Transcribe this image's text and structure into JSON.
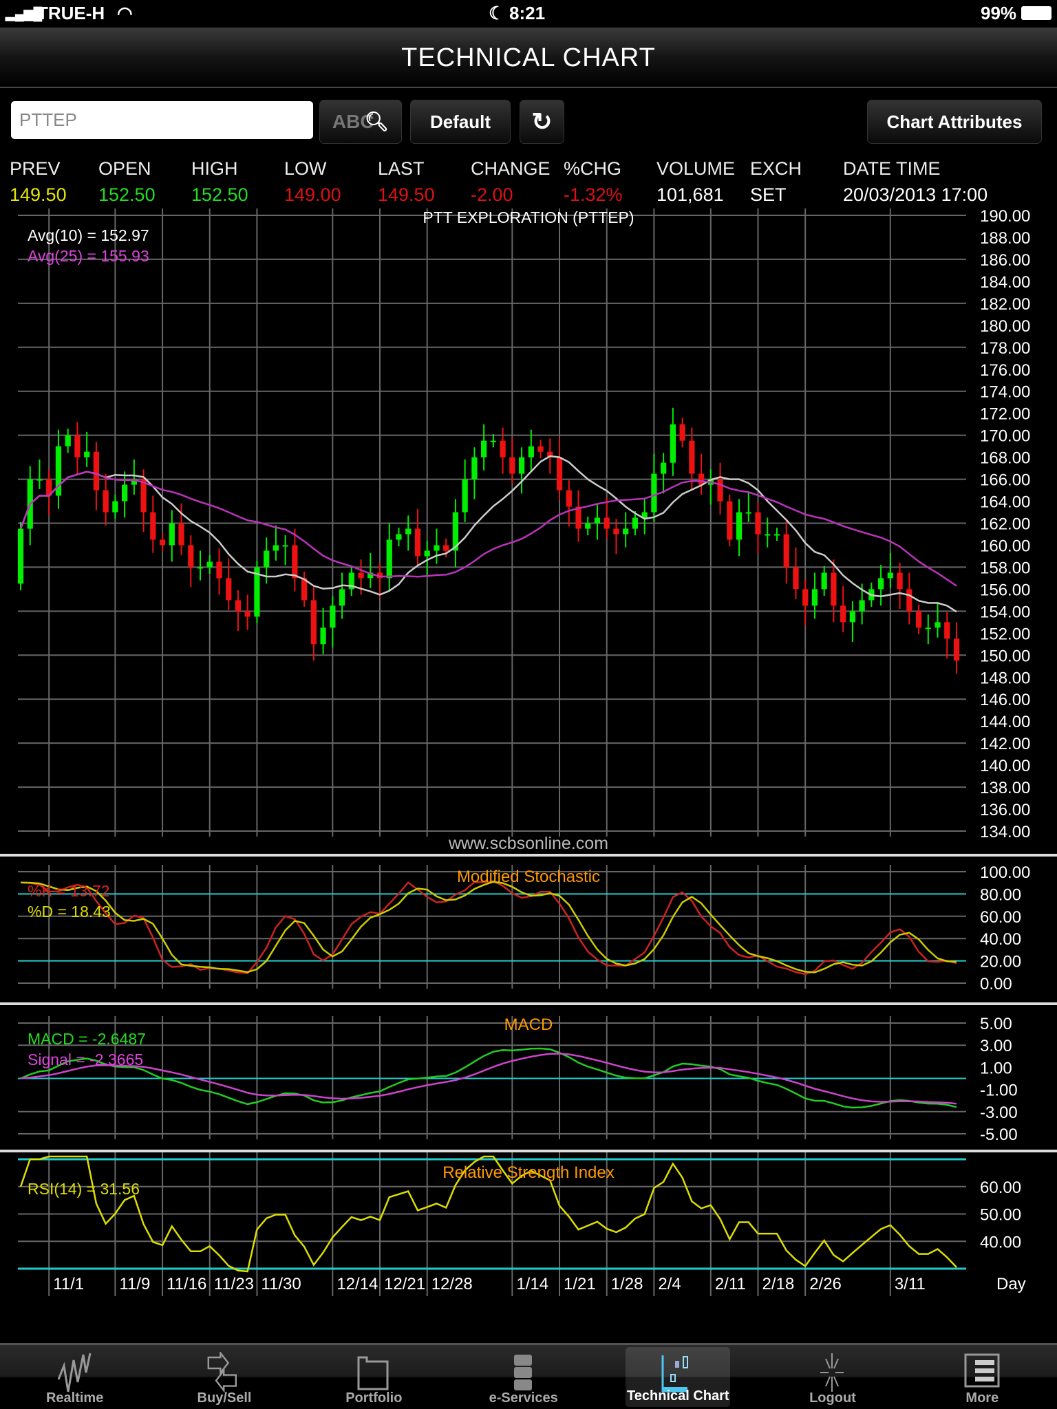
{
  "status": {
    "carrier": "TRUE-H",
    "time": "8:21",
    "battery": "99%"
  },
  "header": {
    "title": "TECHNICAL CHART"
  },
  "toolbar": {
    "symbol_value": "PTTEP",
    "abc_label": "ABC",
    "default_label": "Default",
    "chart_attributes_label": "Chart Attributes"
  },
  "quote": {
    "headers": [
      "PREV",
      "OPEN",
      "HIGH",
      "LOW",
      "LAST",
      "CHANGE",
      "%CHG",
      "VOLUME",
      "EXCH",
      "DATE TIME"
    ],
    "values": [
      "149.50",
      "152.50",
      "152.50",
      "149.00",
      "149.50",
      "-2.00",
      "-1.32%",
      "101,681",
      "SET",
      "20/03/2013 17:00"
    ],
    "colors": [
      "#e6e600",
      "#22dd22",
      "#22dd22",
      "#dd1111",
      "#dd1111",
      "#dd1111",
      "#dd1111",
      "#ffffff",
      "#ffffff",
      "#ffffff"
    ]
  },
  "chart_data": {
    "type": "candlestick",
    "title": "PTT EXPLORATION (PTTEP)",
    "watermark": "www.scbsonline.com",
    "xlabel": "Day",
    "x_labels": [
      {
        "label": "11/1",
        "index": 3
      },
      {
        "label": "11/9",
        "index": 10
      },
      {
        "label": "11/16",
        "index": 15
      },
      {
        "label": "11/23",
        "index": 20
      },
      {
        "label": "11/30",
        "index": 25
      },
      {
        "label": "12/14",
        "index": 33
      },
      {
        "label": "12/21",
        "index": 38
      },
      {
        "label": "12/28",
        "index": 43
      },
      {
        "label": "1/14",
        "index": 52
      },
      {
        "label": "1/21",
        "index": 57
      },
      {
        "label": "1/28",
        "index": 62
      },
      {
        "label": "2/4",
        "index": 67
      },
      {
        "label": "2/11",
        "index": 73
      },
      {
        "label": "2/18",
        "index": 78
      },
      {
        "label": "2/26",
        "index": 83
      },
      {
        "label": "3/11",
        "index": 92
      }
    ],
    "first_open": 156.5,
    "closes": [
      161.5,
      166,
      166,
      164.5,
      169,
      170,
      168,
      168.5,
      165,
      163,
      164,
      165.5,
      166,
      163,
      160.5,
      160,
      162,
      160,
      158,
      158,
      158.5,
      157,
      155,
      154,
      153.5,
      158,
      159.5,
      160,
      160,
      157,
      155,
      151,
      152.5,
      154.5,
      156,
      157.5,
      157,
      157.5,
      157,
      160.5,
      161,
      161.5,
      159,
      159.5,
      160,
      159.5,
      163,
      166,
      168,
      169.5,
      169.5,
      168,
      166.5,
      168,
      169,
      168.5,
      168,
      165,
      163.5,
      161.5,
      162,
      162.5,
      161.5,
      161,
      161.5,
      162.5,
      163,
      166.5,
      167.5,
      171,
      169.5,
      166.5,
      165.5,
      166,
      164,
      160.5,
      163,
      163,
      161,
      161,
      161,
      158,
      156,
      154.5,
      156,
      157.5,
      154.5,
      153,
      154,
      155,
      156,
      157,
      157.5,
      156,
      154,
      152.5,
      152.5,
      153,
      151.5,
      149.5
    ],
    "main": {
      "ylim": [
        134,
        190
      ],
      "ticks": [
        "190.00",
        "188.00",
        "186.00",
        "184.00",
        "182.00",
        "180.00",
        "178.00",
        "176.00",
        "174.00",
        "172.00",
        "170.00",
        "168.00",
        "166.00",
        "164.00",
        "162.00",
        "160.00",
        "158.00",
        "156.00",
        "154.00",
        "152.00",
        "150.00",
        "148.00",
        "146.00",
        "144.00",
        "142.00",
        "140.00",
        "138.00",
        "136.00",
        "134.00"
      ],
      "legend": [
        {
          "text": "Avg(10)  =  152.97",
          "color": "#ffffff"
        },
        {
          "text": "Avg(25)  =  155.93",
          "color": "#dd44dd"
        }
      ],
      "series": [
        {
          "name": "Avg(10)",
          "period": 10,
          "color": "#cccccc"
        },
        {
          "name": "Avg(25)",
          "period": 25,
          "color": "#bb33bb"
        }
      ]
    },
    "stochastic": {
      "title": "Modified Stochastic",
      "ylim": [
        0,
        100
      ],
      "ticks": [
        "100.00",
        "80.00",
        "60.00",
        "40.00",
        "20.00",
        "0.00"
      ],
      "levels": [
        80,
        20
      ],
      "legend": [
        {
          "text": "%K  =  13.72",
          "color": "#dd2222"
        },
        {
          "text": "%D  =  18.43",
          "color": "#dddd00"
        }
      ]
    },
    "macd": {
      "title": "MACD",
      "ylim": [
        -5,
        5
      ],
      "ticks": [
        "5.00",
        "3.00",
        "1.00",
        "-1.00",
        "-3.00",
        "-5.00"
      ],
      "legend": [
        {
          "text": "MACD  =  -2.6487",
          "color": "#22dd22"
        },
        {
          "text": "Signal  =  -2.3665",
          "color": "#dd44dd"
        }
      ]
    },
    "rsi": {
      "title": "Relative Strength Index",
      "ylim": [
        30,
        70
      ],
      "ticks": [
        "60.00",
        "50.00",
        "40.00"
      ],
      "levels": [
        70,
        30
      ],
      "legend": [
        {
          "text": "RSI(14)  =  31.56",
          "color": "#dddd00"
        }
      ]
    },
    "colors": {
      "up": "#00ee00",
      "down": "#ee1111",
      "grid": "#666666",
      "level": "#22cccc",
      "title": "#ff9900"
    }
  },
  "tabs": [
    {
      "label": "Realtime",
      "icon": "pulse-icon"
    },
    {
      "label": "Buy/Sell",
      "icon": "arrows-icon"
    },
    {
      "label": "Portfolio",
      "icon": "folder-icon"
    },
    {
      "label": "e-Services",
      "icon": "cabinet-icon"
    },
    {
      "label": "Technical Chart",
      "icon": "candlestick-icon",
      "active": true
    },
    {
      "label": "Logout",
      "icon": "logout-icon"
    },
    {
      "label": "More",
      "icon": "list-icon"
    }
  ]
}
